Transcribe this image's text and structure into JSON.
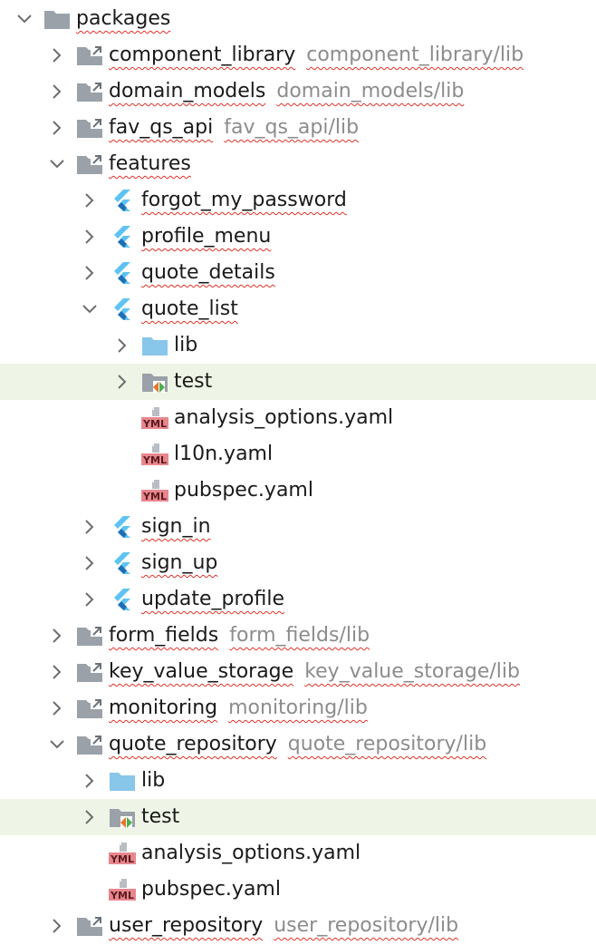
{
  "colors": {
    "highlight_row": "#eef5e6",
    "module_icon": "#9aa1a8",
    "folder_blue": "#88c6ea",
    "flutter_light": "#5ec3f3",
    "flutter_dark": "#1e6fb5",
    "yaml_tag": "#e8868e",
    "path_text": "#8c8c8c",
    "spell_underline": "#e0322a"
  },
  "tree": [
    {
      "name": "packages",
      "path": "",
      "depth": 0,
      "icon": "folder-gray-icon",
      "expanded": true,
      "chevron": true,
      "highlight": false,
      "underline": true
    },
    {
      "name": "component_library",
      "path": "component_library/lib",
      "depth": 1,
      "icon": "module-folder-icon",
      "expanded": false,
      "chevron": true,
      "highlight": false,
      "underline": true
    },
    {
      "name": "domain_models",
      "path": "domain_models/lib",
      "depth": 1,
      "icon": "module-folder-icon",
      "expanded": false,
      "chevron": true,
      "highlight": false,
      "underline": true
    },
    {
      "name": "fav_qs_api",
      "path": "fav_qs_api/lib",
      "depth": 1,
      "icon": "module-folder-icon",
      "expanded": false,
      "chevron": true,
      "highlight": false,
      "underline": true
    },
    {
      "name": "features",
      "path": "",
      "depth": 1,
      "icon": "module-folder-icon",
      "expanded": true,
      "chevron": true,
      "highlight": false,
      "underline": true
    },
    {
      "name": "forgot_my_password",
      "path": "",
      "depth": 2,
      "icon": "flutter-icon",
      "expanded": false,
      "chevron": true,
      "highlight": false,
      "underline": true
    },
    {
      "name": "profile_menu",
      "path": "",
      "depth": 2,
      "icon": "flutter-icon",
      "expanded": false,
      "chevron": true,
      "highlight": false,
      "underline": true
    },
    {
      "name": "quote_details",
      "path": "",
      "depth": 2,
      "icon": "flutter-icon",
      "expanded": false,
      "chevron": true,
      "highlight": false,
      "underline": true
    },
    {
      "name": "quote_list",
      "path": "",
      "depth": 2,
      "icon": "flutter-icon",
      "expanded": true,
      "chevron": true,
      "highlight": false,
      "underline": true
    },
    {
      "name": "lib",
      "path": "",
      "depth": 3,
      "icon": "folder-blue-icon",
      "expanded": false,
      "chevron": true,
      "highlight": false,
      "underline": false
    },
    {
      "name": "test",
      "path": "",
      "depth": 3,
      "icon": "test-folder-icon",
      "expanded": false,
      "chevron": true,
      "highlight": true,
      "underline": false
    },
    {
      "name": "analysis_options.yaml",
      "path": "",
      "depth": 3,
      "icon": "yaml-file-icon",
      "expanded": false,
      "chevron": false,
      "highlight": false,
      "underline": false
    },
    {
      "name": "l10n.yaml",
      "path": "",
      "depth": 3,
      "icon": "yaml-file-icon",
      "expanded": false,
      "chevron": false,
      "highlight": false,
      "underline": false
    },
    {
      "name": "pubspec.yaml",
      "path": "",
      "depth": 3,
      "icon": "yaml-file-icon",
      "expanded": false,
      "chevron": false,
      "highlight": false,
      "underline": false
    },
    {
      "name": "sign_in",
      "path": "",
      "depth": 2,
      "icon": "flutter-icon",
      "expanded": false,
      "chevron": true,
      "highlight": false,
      "underline": true
    },
    {
      "name": "sign_up",
      "path": "",
      "depth": 2,
      "icon": "flutter-icon",
      "expanded": false,
      "chevron": true,
      "highlight": false,
      "underline": true
    },
    {
      "name": "update_profile",
      "path": "",
      "depth": 2,
      "icon": "flutter-icon",
      "expanded": false,
      "chevron": true,
      "highlight": false,
      "underline": true
    },
    {
      "name": "form_fields",
      "path": "form_fields/lib",
      "depth": 1,
      "icon": "module-folder-icon",
      "expanded": false,
      "chevron": true,
      "highlight": false,
      "underline": true
    },
    {
      "name": "key_value_storage",
      "path": "key_value_storage/lib",
      "depth": 1,
      "icon": "module-folder-icon",
      "expanded": false,
      "chevron": true,
      "highlight": false,
      "underline": true
    },
    {
      "name": "monitoring",
      "path": "monitoring/lib",
      "depth": 1,
      "icon": "module-folder-icon",
      "expanded": false,
      "chevron": true,
      "highlight": false,
      "underline": true
    },
    {
      "name": "quote_repository",
      "path": "quote_repository/lib",
      "depth": 1,
      "icon": "module-folder-icon",
      "expanded": true,
      "chevron": true,
      "highlight": false,
      "underline": true
    },
    {
      "name": "lib",
      "path": "",
      "depth": 2,
      "icon": "folder-blue-icon",
      "expanded": false,
      "chevron": true,
      "highlight": false,
      "underline": false
    },
    {
      "name": "test",
      "path": "",
      "depth": 2,
      "icon": "test-folder-icon",
      "expanded": false,
      "chevron": true,
      "highlight": true,
      "underline": false
    },
    {
      "name": "analysis_options.yaml",
      "path": "",
      "depth": 2,
      "icon": "yaml-file-icon",
      "expanded": false,
      "chevron": false,
      "highlight": false,
      "underline": false
    },
    {
      "name": "pubspec.yaml",
      "path": "",
      "depth": 2,
      "icon": "yaml-file-icon",
      "expanded": false,
      "chevron": false,
      "highlight": false,
      "underline": false
    },
    {
      "name": "user_repository",
      "path": "user_repository/lib",
      "depth": 1,
      "icon": "module-folder-icon",
      "expanded": false,
      "chevron": true,
      "highlight": false,
      "underline": true
    }
  ]
}
